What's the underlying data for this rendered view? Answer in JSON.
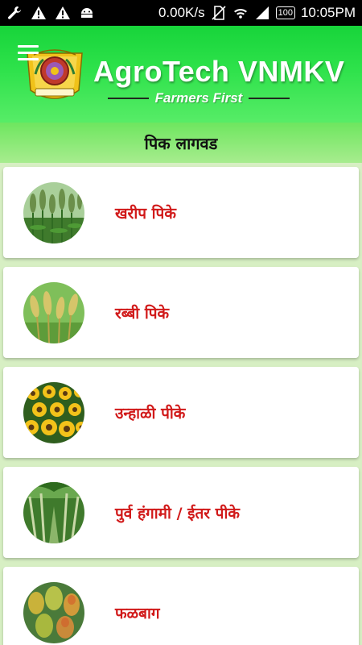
{
  "status_bar": {
    "left_icons": [
      "wrench-icon",
      "warning-icon",
      "warning-icon",
      "android-icon"
    ],
    "speed": "0.00K/s",
    "right_icons": [
      "no-sim-icon",
      "wifi-icon",
      "signal-icon"
    ],
    "battery": "100",
    "time": "10:05PM"
  },
  "header": {
    "title": "AgroTech VNMKV",
    "tagline": "Farmers First",
    "menu_icon": "hamburger-menu-icon",
    "logo_icon": "university-emblem-logo"
  },
  "section": {
    "title": "पिक लागवड"
  },
  "crops": [
    {
      "label": "खरीप पिके",
      "image": "sorghum-field-image"
    },
    {
      "label": "रब्बी पिके",
      "image": "wheat-ears-image"
    },
    {
      "label": "उन्हाळी पीके",
      "image": "sunflower-field-image"
    },
    {
      "label": "पुर्व हंगामी / ईतर पीके",
      "image": "sugarcane-field-image"
    },
    {
      "label": "फळबाग",
      "image": "mango-fruits-image"
    }
  ],
  "colors": {
    "header_green": "#2ee24b",
    "label_red": "#d11a1a",
    "background": "#d7efc3"
  }
}
